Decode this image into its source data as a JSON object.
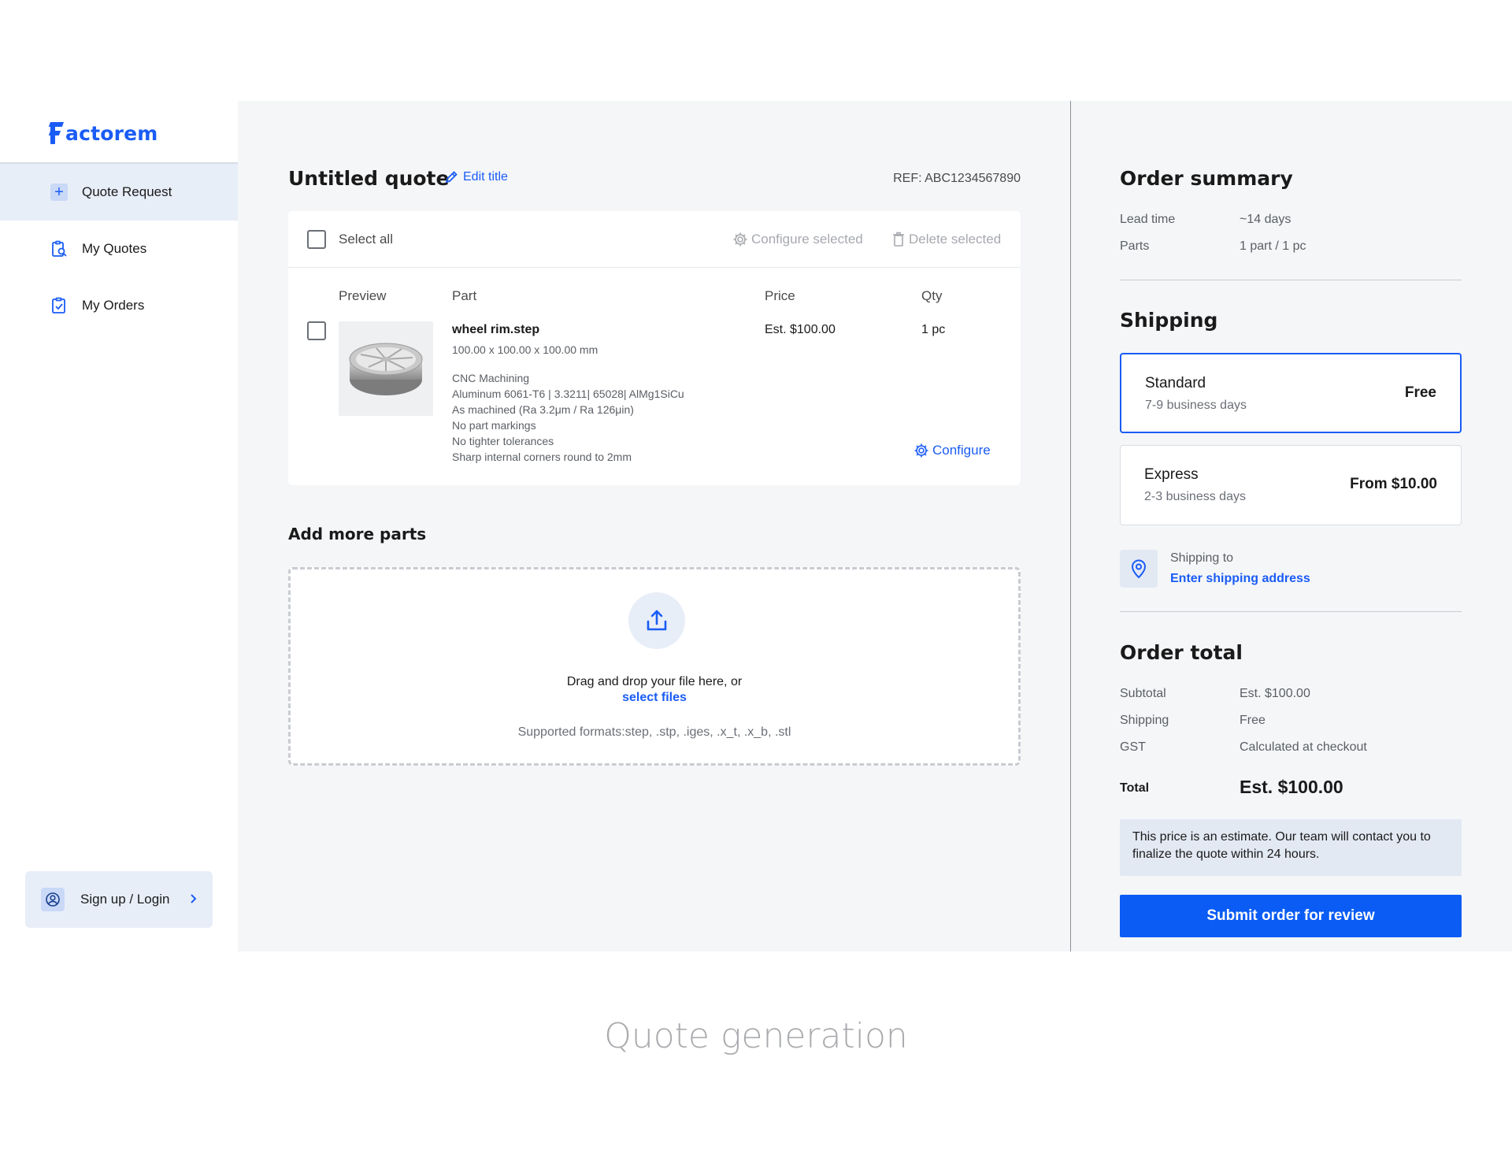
{
  "brand": {
    "name": "actorem",
    "accent": "#1a5cf5"
  },
  "sidebar": {
    "items": [
      {
        "label": "Quote Request",
        "icon": "plus-icon",
        "active": true
      },
      {
        "label": "My Quotes",
        "icon": "clipboard-search-icon",
        "active": false
      },
      {
        "label": "My Orders",
        "icon": "clipboard-check-icon",
        "active": false
      }
    ],
    "login_label": "Sign up / Login"
  },
  "quote": {
    "title": "Untitled quote",
    "edit_title_label": "Edit title",
    "ref": "REF: ABC1234567890",
    "toolbar": {
      "select_all": "Select all",
      "configure_selected": "Configure selected",
      "delete_selected": "Delete selected"
    },
    "columns": {
      "preview": "Preview",
      "part": "Part",
      "price": "Price",
      "qty": "Qty"
    },
    "parts": [
      {
        "name": "wheel rim.step",
        "dims": "100.00 x 100.00 x 100.00 mm",
        "specs": [
          "CNC Machining",
          "Aluminum 6061-T6 | 3.3211| 65028| AlMg1SiCu",
          "As machined (Ra 3.2μm / Ra 126μin)",
          "No part markings",
          "No tighter tolerances",
          "Sharp internal corners round to 2mm"
        ],
        "price": "Est. $100.00",
        "qty": "1 pc",
        "configure_label": "Configure"
      }
    ]
  },
  "add_parts": {
    "heading": "Add more parts",
    "drop_text": "Drag and drop your file here, or",
    "select_link": "select files",
    "formats": "Supported formats:step, .stp, .iges, .x_t, .x_b, .stl"
  },
  "summary": {
    "heading": "Order summary",
    "lead_time_label": "Lead time",
    "lead_time_value": "~14 days",
    "parts_label": "Parts",
    "parts_value": "1 part / 1 pc"
  },
  "shipping": {
    "heading": "Shipping",
    "options": [
      {
        "name": "Standard",
        "days": "7-9 business days",
        "price": "Free",
        "selected": true
      },
      {
        "name": "Express",
        "days": "2-3 business days",
        "price": "From $10.00",
        "selected": false
      }
    ],
    "ship_to_label": "Shipping to",
    "ship_to_link": "Enter shipping address"
  },
  "total": {
    "heading": "Order total",
    "subtotal_label": "Subtotal",
    "subtotal_value": "Est. $100.00",
    "shipping_label": "Shipping",
    "shipping_value": "Free",
    "gst_label": "GST",
    "gst_value": "Calculated at checkout",
    "total_label": "Total",
    "total_value": "Est. $100.00",
    "note": "This price is an estimate. Our team will contact you to finalize the quote within 24 hours.",
    "submit_label": "Submit order for review"
  },
  "caption": "Quote generation"
}
